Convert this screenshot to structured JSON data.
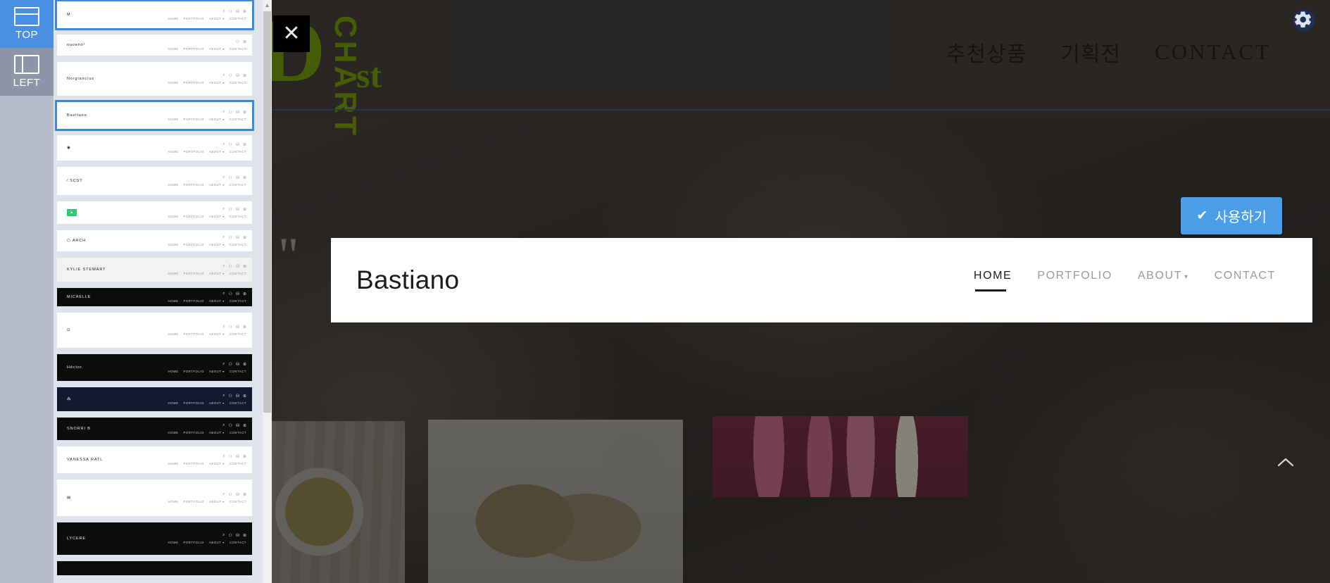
{
  "rail": {
    "tabs": [
      {
        "label": "TOP",
        "icon": "layout-top-icon",
        "active": true
      },
      {
        "label": "LEFT",
        "icon": "layout-left-icon",
        "active": false
      }
    ]
  },
  "close_button": {
    "glyph": "✕",
    "icon": "close-icon"
  },
  "thumbnail_panel": {
    "scrollbar": {
      "up_arrow": "▲"
    },
    "items": [
      {
        "brand": "M",
        "theme": "light",
        "selected": true,
        "nav": [
          "HOME",
          "PORTFOLIO",
          "ABOUT ▾",
          "CONTACT"
        ],
        "icons": [
          "search-icon",
          "user-icon",
          "bag-icon",
          "globe-icon"
        ]
      },
      {
        "brand": "nuoeno¹",
        "theme": "light",
        "selected": false,
        "nav": [
          "HOME",
          "PORTFOLIO",
          "ABOUT ▾",
          "CONTACT"
        ],
        "icons": [
          "user-icon",
          "globe-icon"
        ]
      },
      {
        "brand": "Norgiancius",
        "theme": "light",
        "selected": false,
        "nav": [
          "HOME",
          "PORTFOLIO",
          "ABOUT ▾",
          "CONTACT"
        ],
        "icons": [
          "search-icon",
          "user-icon",
          "bag-icon",
          "globe-icon"
        ]
      },
      {
        "brand": "Bastiano",
        "theme": "light",
        "selected": true,
        "nav": [
          "HOME",
          "PORTFOLIO",
          "ABOUT ▾",
          "CONTACT"
        ],
        "icons": [
          "search-icon",
          "user-icon",
          "bag-icon",
          "globe-icon"
        ]
      },
      {
        "brand": "◉",
        "theme": "light",
        "selected": false,
        "nav": [
          "HOME",
          "PORTFOLIO",
          "ABOUT ▾",
          "CONTACT"
        ],
        "icons": [
          "search-icon",
          "user-icon",
          "bag-icon",
          "globe-icon"
        ]
      },
      {
        "brand": "⁄ SCST",
        "theme": "light",
        "selected": false,
        "nav": [
          "HOME",
          "PORTFOLIO",
          "ABOUT ▾",
          "CONTACT"
        ],
        "icons": [
          "search-icon",
          "user-icon",
          "bag-icon",
          "globe-icon"
        ]
      },
      {
        "brand": "▲",
        "theme": "light",
        "selected": false,
        "nav": [
          "HOME",
          "PORTFOLIO",
          "ABOUT ▾",
          "CONTACT"
        ],
        "icons": [
          "search-icon",
          "user-icon",
          "bag-icon",
          "globe-icon"
        ],
        "badge_color": "#2ecc71"
      },
      {
        "brand": "⬡ ARCH",
        "theme": "light",
        "selected": false,
        "nav": [
          "HOME",
          "PORTFOLIO",
          "ABOUT ▾",
          "CONTACT"
        ],
        "icons": [
          "search-icon",
          "user-icon",
          "bag-icon",
          "globe-icon"
        ]
      },
      {
        "brand": "KYLIE STEWART",
        "theme": "gray",
        "selected": false,
        "nav": [
          "HOME",
          "PORTFOLIO",
          "ABOUT ▾",
          "CONTACT"
        ],
        "icons": [
          "search-icon",
          "user-icon",
          "bag-icon",
          "globe-icon"
        ]
      },
      {
        "brand": "MICAELLE",
        "theme": "dark",
        "selected": false,
        "nav": [
          "HOME",
          "PORTFOLIO",
          "ABOUT ▾",
          "CONTACT"
        ],
        "icons": [
          "search-icon",
          "user-icon",
          "bag-icon",
          "globe-icon"
        ]
      },
      {
        "brand": "⊡",
        "theme": "light",
        "selected": false,
        "nav": [
          "HOME",
          "PORTFOLIO",
          "ABOUT ▾",
          "CONTACT"
        ],
        "icons": [
          "search-icon",
          "user-icon",
          "bag-icon",
          "globe-icon"
        ]
      },
      {
        "brand": "Héctor.",
        "theme": "dark",
        "selected": false,
        "nav": [
          "HOME",
          "PORTFOLIO",
          "ABOUT ▾",
          "CONTACT"
        ],
        "icons": [
          "search-icon",
          "user-icon",
          "bag-icon",
          "globe-icon"
        ]
      },
      {
        "brand": "⁂",
        "theme": "navy",
        "selected": false,
        "nav": [
          "HOME",
          "PORTFOLIO",
          "ABOUT ▾",
          "CONTACT"
        ],
        "icons": [
          "search-icon",
          "user-icon",
          "bag-icon",
          "globe-icon"
        ]
      },
      {
        "brand": "SNORRI B",
        "theme": "dark",
        "selected": false,
        "nav": [
          "HOME",
          "PORTFOLIO",
          "ABOUT ▾",
          "CONTACT"
        ],
        "icons": [
          "search-icon",
          "user-icon",
          "bag-icon",
          "globe-icon"
        ]
      },
      {
        "brand": "VANESSA RATL",
        "theme": "light",
        "selected": false,
        "nav": [
          "HOME",
          "PORTFOLIO",
          "ABOUT ▾",
          "CONTACT"
        ],
        "icons": [
          "search-icon",
          "user-icon",
          "bag-icon",
          "globe-icon"
        ]
      },
      {
        "brand": "▤",
        "theme": "light",
        "selected": false,
        "nav": [
          "HOME",
          "PORTFOLIO",
          "ABOUT ▾",
          "CONTACT"
        ],
        "icons": [
          "search-icon",
          "user-icon",
          "bag-icon",
          "globe-icon"
        ]
      },
      {
        "brand": "LYCERE",
        "theme": "dark",
        "selected": false,
        "nav": [
          "HOME",
          "PORTFOLIO",
          "ABOUT ▾",
          "CONTACT"
        ],
        "icons": [
          "search-icon",
          "user-icon",
          "bag-icon",
          "globe-icon"
        ]
      },
      {
        "brand": "",
        "theme": "dark",
        "selected": false,
        "nav": [],
        "icons": []
      }
    ]
  },
  "preview": {
    "ghost_logo": {
      "big": "D",
      "vertical": "CHART",
      "small": "st"
    },
    "site_nav": [
      {
        "label": "추천상품",
        "latin": false
      },
      {
        "label": "기획전",
        "latin": false
      },
      {
        "label": "CONTACT",
        "latin": true
      }
    ],
    "gear_icon": "gear-icon",
    "use_button": {
      "check": "✔",
      "label": "사용하기",
      "color": "#4a9fe8"
    },
    "quote_mark": "\"",
    "template_header": {
      "brand": "Bastiano",
      "menu": [
        {
          "label": "HOME",
          "active": true,
          "caret": ""
        },
        {
          "label": "PORTFOLIO",
          "active": false,
          "caret": ""
        },
        {
          "label": "ABOUT",
          "active": false,
          "caret": "▾"
        },
        {
          "label": "CONTACT",
          "active": false,
          "caret": ""
        }
      ]
    },
    "scroll_top": {
      "glyph": "❮",
      "icon": "chevron-up-icon"
    }
  }
}
